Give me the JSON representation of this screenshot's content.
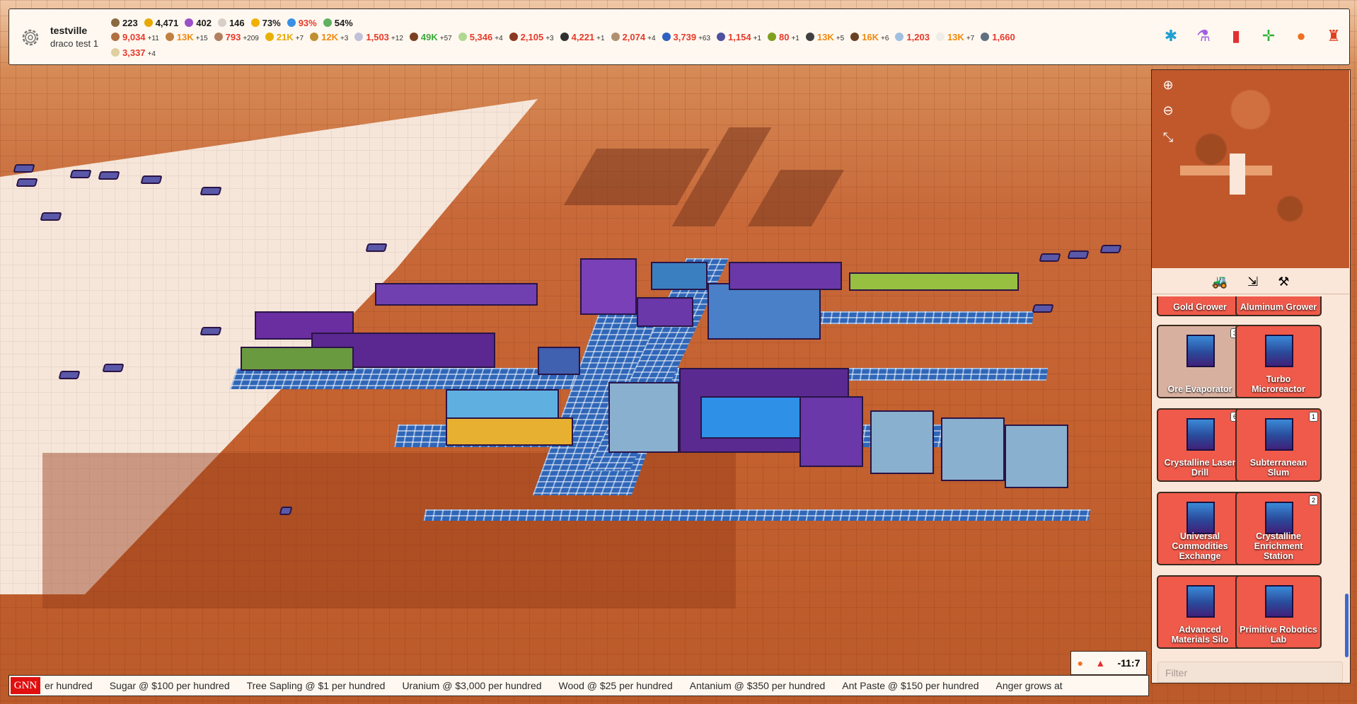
{
  "city": {
    "name": "testville",
    "subtitle": "draco test 1"
  },
  "resources_row1": [
    {
      "icon": "worker-icon",
      "value": "223",
      "delta": "",
      "color": "#1a1a1a",
      "class": "c-dark",
      "dot": "#8a6a40"
    },
    {
      "icon": "coin-icon",
      "value": "4,471",
      "delta": "",
      "color": "#1a1a1a",
      "class": "c-dark",
      "dot": "#e8a800"
    },
    {
      "icon": "potion-icon",
      "value": "402",
      "delta": "",
      "color": "#1a1a1a",
      "class": "c-dark",
      "dot": "#9a50c8"
    },
    {
      "icon": "pile-icon",
      "value": "146",
      "delta": "",
      "color": "#1a1a1a",
      "class": "c-dark",
      "dot": "#d8d0c8"
    },
    {
      "icon": "lightning-icon",
      "value": "73%",
      "delta": "",
      "color": "#1a1a1a",
      "class": "c-dark",
      "dot": "#f0b000"
    },
    {
      "icon": "water-icon",
      "value": "93%",
      "delta": "",
      "color": "#e63a2a",
      "class": "c-red",
      "dot": "#3a90e0"
    },
    {
      "icon": "flask-icon",
      "value": "54%",
      "delta": "",
      "color": "#1a1a1a",
      "class": "c-dark",
      "dot": "#60b060"
    }
  ],
  "resources_row2": [
    {
      "icon": "pickaxe-icon",
      "value": "9,034",
      "delta": "+11",
      "class": "c-red",
      "dot": "#b07040"
    },
    {
      "icon": "bread-icon",
      "value": "13K",
      "delta": "+15",
      "class": "c-orange",
      "dot": "#c08040"
    },
    {
      "icon": "ore-icon",
      "value": "793",
      "delta": "+209",
      "class": "c-red",
      "dot": "#b08060"
    },
    {
      "icon": "radiation-icon",
      "value": "21K",
      "delta": "+7",
      "class": "c-yellow",
      "dot": "#e8b000"
    },
    {
      "icon": "gear-part-icon",
      "value": "12K",
      "delta": "+3",
      "class": "c-orange",
      "dot": "#c09030"
    },
    {
      "icon": "crystal-icon",
      "value": "1,503",
      "delta": "+12",
      "class": "c-red",
      "dot": "#c0c0d8"
    },
    {
      "icon": "soil-icon",
      "value": "49K",
      "delta": "+57",
      "class": "c-green",
      "dot": "#7a4020"
    },
    {
      "icon": "cabbage-icon",
      "value": "5,346",
      "delta": "+4",
      "class": "c-red",
      "dot": "#b0d890"
    },
    {
      "icon": "sausage-icon",
      "value": "2,105",
      "delta": "+3",
      "class": "c-red",
      "dot": "#8a3a20"
    },
    {
      "icon": "coal-icon",
      "value": "4,221",
      "delta": "+1",
      "class": "c-red",
      "dot": "#303030"
    },
    {
      "icon": "stone-icon",
      "value": "2,074",
      "delta": "+4",
      "class": "c-red",
      "dot": "#b09070"
    },
    {
      "icon": "feather-icon",
      "value": "3,739",
      "delta": "+63",
      "class": "c-red",
      "dot": "#3060c0"
    },
    {
      "icon": "chip-icon",
      "value": "1,154",
      "delta": "+1",
      "class": "c-red",
      "dot": "#5050a0"
    },
    {
      "icon": "board-icon",
      "value": "80",
      "delta": "+1",
      "class": "c-red",
      "dot": "#80a020"
    },
    {
      "icon": "canister-icon",
      "value": "13K",
      "delta": "+5",
      "class": "c-orange",
      "dot": "#404040"
    },
    {
      "icon": "bottle-icon",
      "value": "16K",
      "delta": "+6",
      "class": "c-orange",
      "dot": "#6a4020"
    },
    {
      "icon": "paper-icon",
      "value": "1,203",
      "delta": "",
      "class": "c-red",
      "dot": "#a0c0e0"
    },
    {
      "icon": "sugar-icon",
      "value": "13K",
      "delta": "+7",
      "class": "c-orange",
      "dot": "#f0ece8"
    },
    {
      "icon": "metal-ball-icon",
      "value": "1,660",
      "delta": "",
      "class": "c-red",
      "dot": "#607080"
    }
  ],
  "resources_row3": [
    {
      "icon": "seed-icon",
      "value": "3,337",
      "delta": "+4",
      "class": "c-red",
      "dot": "#e0d0a0"
    }
  ],
  "toolbar": [
    {
      "name": "citizen-icon",
      "glyph": "✱",
      "color": "#20a0d0"
    },
    {
      "name": "potion-tool-icon",
      "glyph": "⚗",
      "color": "#a060e0"
    },
    {
      "name": "bookmark-icon",
      "glyph": "▮",
      "color": "#e03030"
    },
    {
      "name": "move-icon",
      "glyph": "✛",
      "color": "#30b030"
    },
    {
      "name": "helmet-icon",
      "glyph": "●",
      "color": "#f07020"
    },
    {
      "name": "robot-icon",
      "glyph": "♜",
      "color": "#e04020"
    }
  ],
  "map_controls": {
    "zoom_in": "⊕",
    "zoom_out": "⊖",
    "collapse": "⤡"
  },
  "panel_tabs": [
    {
      "name": "tab-build-icon",
      "glyph": "🚜"
    },
    {
      "name": "tab-shrink-icon",
      "glyph": "⇲"
    },
    {
      "name": "tab-tools-icon",
      "glyph": "⚒"
    }
  ],
  "buildings": [
    {
      "label": "Gold Grower",
      "count": "",
      "partial": true,
      "selected": false
    },
    {
      "label": "Aluminum Grower",
      "count": "",
      "partial": true,
      "selected": false
    },
    {
      "label": "Ore Evaporator",
      "count": "3",
      "partial": false,
      "selected": true
    },
    {
      "label": "Turbo Microreactor",
      "count": "",
      "partial": false,
      "selected": false
    },
    {
      "label": "Crystalline Laser Drill",
      "count": "6",
      "partial": false,
      "selected": false
    },
    {
      "label": "Subterranean Slum",
      "count": "1",
      "partial": false,
      "selected": false
    },
    {
      "label": "Universal Commodities Exchange",
      "count": "",
      "partial": false,
      "selected": false
    },
    {
      "label": "Crystalline Enrichment Station",
      "count": "2",
      "partial": false,
      "selected": false
    },
    {
      "label": "Advanced Materials Silo",
      "count": "",
      "partial": false,
      "selected": false
    },
    {
      "label": "Primitive Robotics Lab",
      "count": "",
      "partial": false,
      "selected": false
    }
  ],
  "filter": {
    "placeholder": "Filter"
  },
  "clock": {
    "value": "-11:7"
  },
  "ticker": {
    "badge": "GNN",
    "items": [
      "er hundred",
      "Sugar @ $100 per hundred",
      "Tree Sapling @ $1 per hundred",
      "Uranium @ $3,000 per hundred",
      "Wood @ $25 per hundred",
      "Antanium @ $350 per hundred",
      "Ant Paste @ $150 per hundred",
      "Anger grows at"
    ]
  }
}
